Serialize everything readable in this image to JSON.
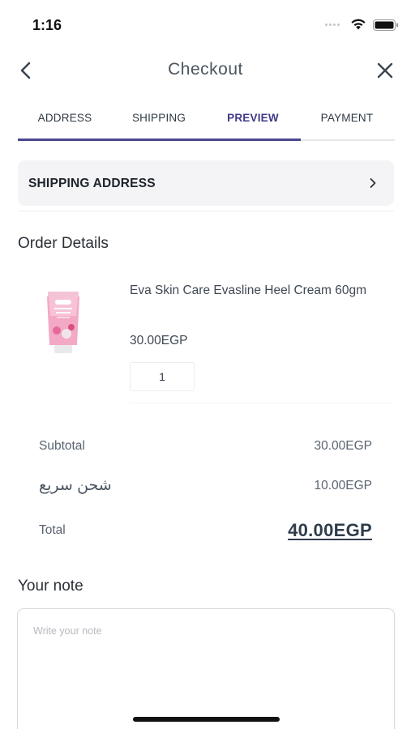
{
  "status_bar": {
    "time": "1:16",
    "icons": [
      "signal-dots-icon",
      "wifi-icon",
      "battery-icon"
    ]
  },
  "nav": {
    "title": "Checkout",
    "back_icon": "chevron-left-icon",
    "close_icon": "close-icon"
  },
  "tabs": {
    "items": [
      {
        "label": "ADDRESS"
      },
      {
        "label": "SHIPPING"
      },
      {
        "label": "PREVIEW"
      },
      {
        "label": "PAYMENT"
      }
    ],
    "active": "PREVIEW",
    "progress_fraction": 0.75
  },
  "shipping_address": {
    "label": "SHIPPING ADDRESS",
    "icon": "chevron-right-icon"
  },
  "order_details": {
    "title": "Order Details",
    "item": {
      "name": "Eva Skin Care Evasline Heel Cream 60gm",
      "price": "30.00EGP",
      "quantity": "1",
      "image_icon": "pink-cream-tube-image"
    }
  },
  "summary": {
    "subtotal_label": "Subtotal",
    "subtotal_value": "30.00EGP",
    "shipping_label": "شحن سريع",
    "shipping_value": "10.00EGP",
    "total_label": "Total",
    "total_value": "40.00EGP"
  },
  "note": {
    "title": "Your note",
    "placeholder": "Write your note",
    "value": ""
  },
  "colors": {
    "accent": "#4a4690",
    "text_dark": "#2f3a45",
    "row_bg": "#f4f4f6"
  }
}
